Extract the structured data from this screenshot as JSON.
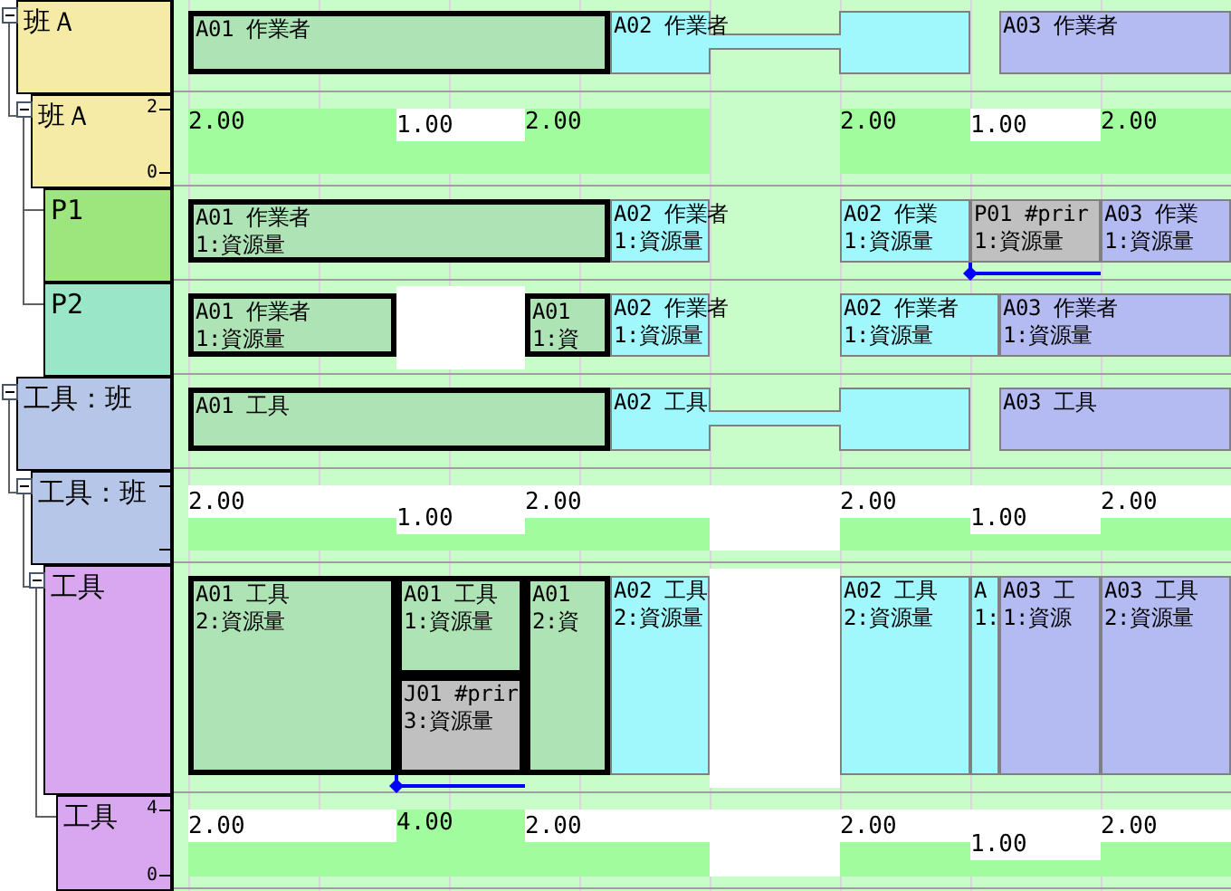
{
  "tree": [
    {
      "label": "班Ａ",
      "color": "#f5eaa6",
      "expanded": true,
      "lane": {
        "kind": "bars",
        "bars": [
          {
            "title": "A01 作業者",
            "color": "#ade3b5",
            "selected": true
          },
          {
            "title": "A02 作業者",
            "color": "#a0f8fc",
            "selected": false
          },
          {
            "title": "A03 作業者",
            "color": "#b4bbf2",
            "selected": false
          }
        ]
      },
      "children": [
        {
          "label": "班Ａ",
          "color": "#f5eaa6",
          "expanded": true,
          "lane": {
            "kind": "load",
            "ticks": [
              "2",
              "0"
            ],
            "segments": [
              {
                "kind": "value",
                "value": "2.00"
              },
              {
                "kind": "value",
                "value": "1.00"
              },
              {
                "kind": "value",
                "value": "2.00"
              },
              {
                "kind": "none"
              },
              {
                "kind": "value",
                "value": "2.00"
              },
              {
                "kind": "value",
                "value": "1.00"
              },
              {
                "kind": "value",
                "value": "2.00"
              }
            ]
          },
          "children": [
            {
              "label": "P1",
              "color": "#9de67e",
              "lane": {
                "kind": "bars",
                "bars": [
                  {
                    "title": "A01 作業者",
                    "detail": "1:資源量",
                    "color": "#ade3b5",
                    "selected": true,
                    "linked": false
                  },
                  {
                    "title": "A02 作業者",
                    "detail": "1:資源量",
                    "color": "#a0f8fc",
                    "selected": false,
                    "linked": false
                  },
                  {
                    "title": "A02 作業",
                    "detail": "1:資源量",
                    "color": "#a0f8fc",
                    "selected": false,
                    "linked": false
                  },
                  {
                    "title": "P01 #prir",
                    "detail": "1:資源量",
                    "color": "#c0c0c0",
                    "selected": false,
                    "linked": true
                  },
                  {
                    "title": "A03 作業",
                    "detail": "1:資源量",
                    "color": "#b4bbf2",
                    "selected": false,
                    "linked": false
                  }
                ]
              }
            },
            {
              "label": "P2",
              "color": "#99e6c8",
              "lane": {
                "kind": "bars",
                "bars": [
                  {
                    "kind": "task",
                    "title": "A01 作業者",
                    "detail": "1:資源量",
                    "color": "#ade3b5",
                    "selected": true
                  },
                  {
                    "kind": "gap"
                  },
                  {
                    "kind": "task",
                    "title": "A01",
                    "detail": "1:資",
                    "color": "#ade3b5",
                    "selected": true
                  },
                  {
                    "kind": "task",
                    "title": "A02 作業者",
                    "detail": "1:資源量",
                    "color": "#a0f8fc",
                    "selected": false
                  },
                  {
                    "kind": "task",
                    "title": "A02 作業者",
                    "detail": "1:資源量",
                    "color": "#a0f8fc",
                    "selected": false
                  },
                  {
                    "kind": "task",
                    "title": "A03 作業者",
                    "detail": "1:資源量",
                    "color": "#b4bbf2",
                    "selected": false
                  }
                ]
              }
            }
          ]
        }
      ]
    },
    {
      "label": "工具：班",
      "color": "#b6c6e8",
      "expanded": true,
      "lane": {
        "kind": "bars",
        "bars": [
          {
            "title": "A01 工具",
            "color": "#ade3b5",
            "selected": true
          },
          {
            "title": "A02 工具",
            "color": "#a0f8fc",
            "selected": false
          },
          {
            "title": "A03 工具",
            "color": "#b4bbf2",
            "selected": false
          }
        ]
      },
      "children": [
        {
          "label": "工具：班",
          "color": "#b6c6e8",
          "expanded": true,
          "lane": {
            "kind": "load",
            "segments": [
              {
                "kind": "value",
                "value": "2.00"
              },
              {
                "kind": "value",
                "value": "1.00"
              },
              {
                "kind": "value",
                "value": "2.00"
              },
              {
                "kind": "empty"
              },
              {
                "kind": "value",
                "value": "2.00"
              },
              {
                "kind": "value",
                "value": "1.00"
              },
              {
                "kind": "value",
                "value": "2.00"
              }
            ]
          },
          "children": [
            {
              "label": "工具",
              "color": "#d9a6f0",
              "expanded": true,
              "lane": {
                "kind": "bars",
                "bars": [
                  {
                    "kind": "task",
                    "title": "A01 工具",
                    "detail": "2:資源量",
                    "color": "#ade3b5",
                    "selected": true,
                    "linked": false
                  },
                  {
                    "kind": "task",
                    "title": "A01 工具",
                    "detail": "1:資源量",
                    "color": "#ade3b5",
                    "selected": true,
                    "linked": false
                  },
                  {
                    "kind": "task",
                    "title": "J01 #prir",
                    "detail": "3:資源量",
                    "color": "#c0c0c0",
                    "selected": true,
                    "linked": true
                  },
                  {
                    "kind": "task",
                    "title": "A01",
                    "detail": "2:資",
                    "color": "#ade3b5",
                    "selected": true,
                    "linked": false
                  },
                  {
                    "kind": "task",
                    "title": "A02 工具",
                    "detail": "2:資源量",
                    "color": "#a0f8fc",
                    "selected": false,
                    "linked": false
                  },
                  {
                    "kind": "gap"
                  },
                  {
                    "kind": "task",
                    "title": "A02 工具",
                    "detail": "2:資源量",
                    "color": "#a0f8fc",
                    "selected": false,
                    "linked": false
                  },
                  {
                    "kind": "task",
                    "title": "A",
                    "detail": "1:",
                    "color": "#a0f8fc",
                    "selected": false,
                    "linked": false
                  },
                  {
                    "kind": "task",
                    "title": "A03 工",
                    "detail": "1:資源",
                    "color": "#b4bbf2",
                    "selected": false,
                    "linked": false
                  },
                  {
                    "kind": "task",
                    "title": "A03 工具",
                    "detail": "2:資源量",
                    "color": "#b4bbf2",
                    "selected": false,
                    "linked": false
                  }
                ]
              },
              "children": [
                {
                  "label": "工具",
                  "color": "#d9a6f0",
                  "lane": {
                    "kind": "load",
                    "ticks": [
                      "4",
                      "0"
                    ],
                    "segments": [
                      {
                        "kind": "value",
                        "value": "2.00"
                      },
                      {
                        "kind": "value",
                        "value": "4.00"
                      },
                      {
                        "kind": "value",
                        "value": "2.00"
                      },
                      {
                        "kind": "empty"
                      },
                      {
                        "kind": "value",
                        "value": "2.00"
                      },
                      {
                        "kind": "value",
                        "value": "1.00"
                      },
                      {
                        "kind": "value",
                        "value": "2.00"
                      }
                    ]
                  }
                }
              ]
            }
          ]
        }
      ]
    }
  ]
}
